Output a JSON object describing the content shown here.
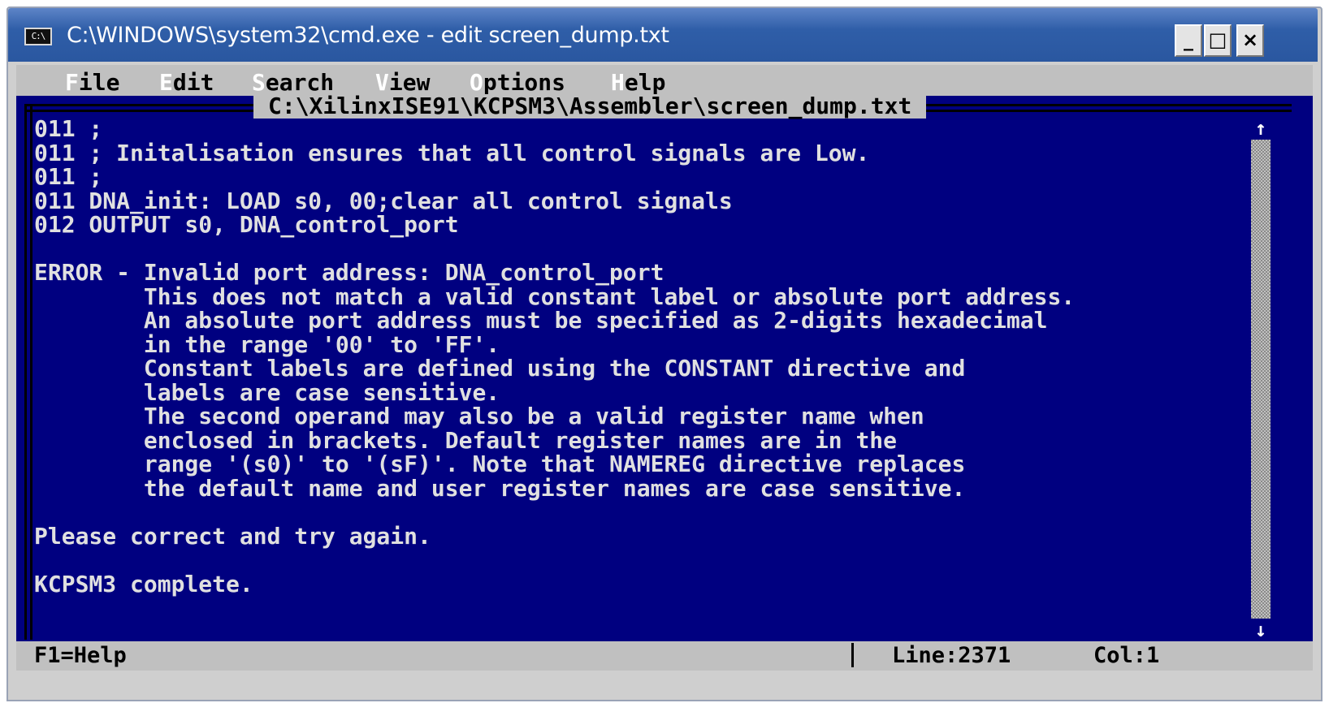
{
  "window": {
    "title": "C:\\WINDOWS\\system32\\cmd.exe - edit screen_dump.txt",
    "icon_label": "C:\\",
    "controls": {
      "minimize": "_",
      "maximize": "□",
      "close": "×"
    }
  },
  "menu": {
    "items": [
      {
        "hot": "F",
        "rest": "ile"
      },
      {
        "hot": "E",
        "rest": "dit"
      },
      {
        "hot": "S",
        "rest": "earch"
      },
      {
        "hot": "V",
        "rest": "iew"
      },
      {
        "hot": "O",
        "rest": "ptions"
      },
      {
        "hot": "H",
        "rest": "elp"
      }
    ]
  },
  "editor": {
    "filename": "C:\\XilinxISE91\\KCPSM3\\Assembler\\screen_dump.txt",
    "lines": [
      "011 ;",
      "011 ; Initalisation ensures that all control signals are Low.",
      "011 ;",
      "011 DNA_init: LOAD s0, 00;clear all control signals",
      "012 OUTPUT s0, DNA_control_port",
      "",
      "ERROR - Invalid port address: DNA_control_port",
      "        This does not match a valid constant label or absolute port address.",
      "        An absolute port address must be specified as 2-digits hexadecimal",
      "        in the range '00' to 'FF'.",
      "        Constant labels are defined using the CONSTANT directive and",
      "        labels are case sensitive.",
      "        The second operand may also be a valid register name when",
      "        enclosed in brackets. Default register names are in the",
      "        range '(s0)' to '(sF)'. Note that NAMEREG directive replaces",
      "        the default name and user register names are case sensitive.",
      "",
      "Please correct and try again.",
      "",
      "KCPSM3 complete."
    ]
  },
  "scrollbar": {
    "up_arrow": "↑",
    "down_arrow": "↓"
  },
  "status": {
    "help": "F1=Help",
    "line": "Line:2371",
    "col": "Col:1"
  },
  "colors": {
    "titlebar": "#2f5ea8",
    "editor_background": "#000080",
    "editor_text": "#e0e0e0",
    "menu_background": "#c0c0c0"
  }
}
